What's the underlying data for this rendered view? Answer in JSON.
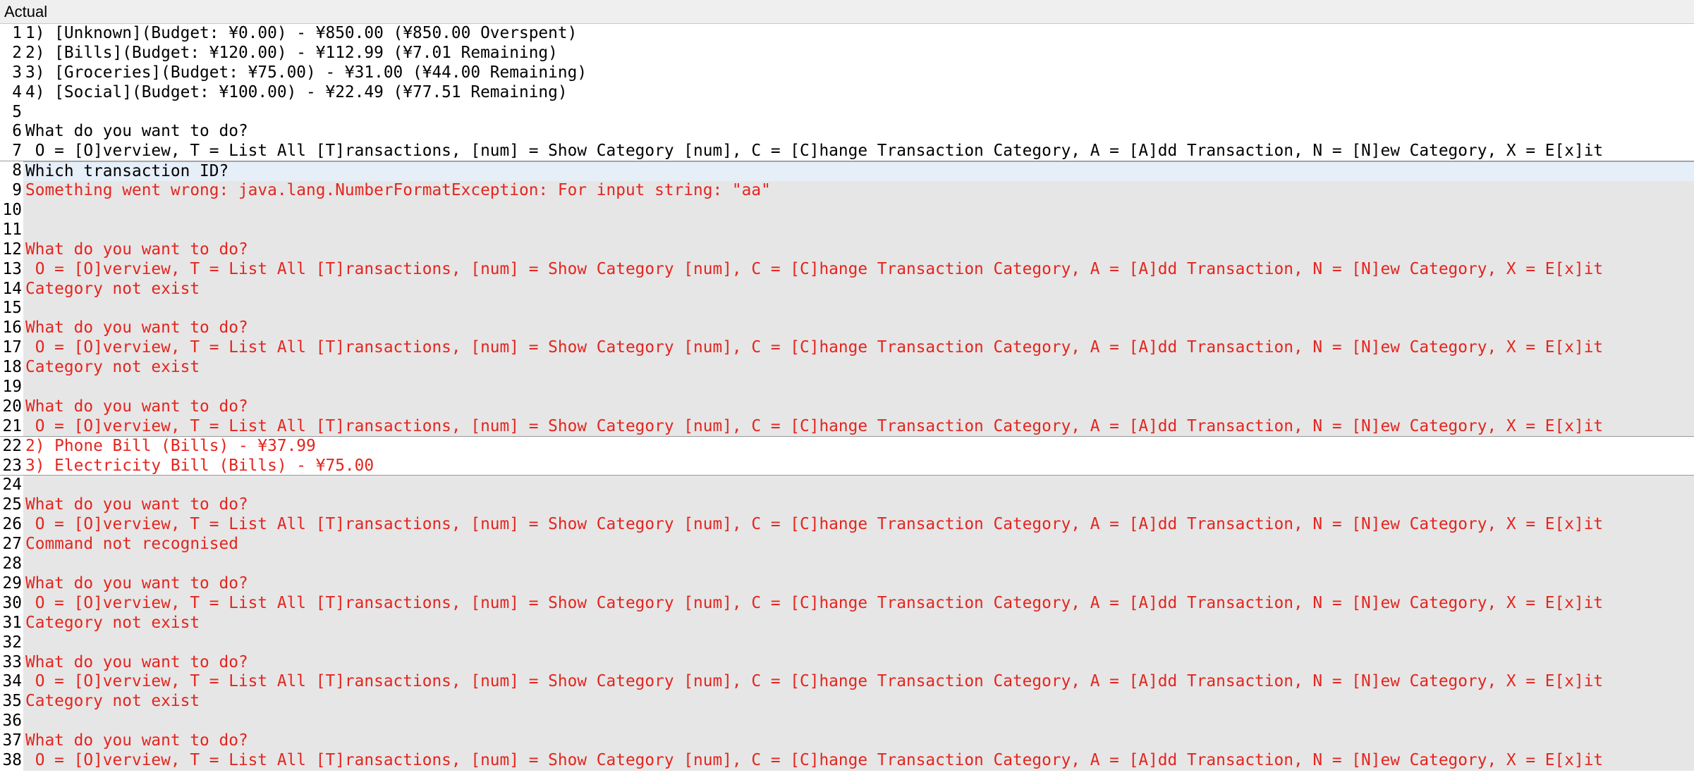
{
  "panel": {
    "title": "Actual"
  },
  "lines": [
    {
      "num": "1",
      "text": "1) [Unknown](Budget: ¥0.00) - ¥850.00 (¥850.00 Overspent)",
      "state": "normal"
    },
    {
      "num": "2",
      "text": "2) [Bills](Budget: ¥120.00) - ¥112.99 (¥7.01 Remaining)",
      "state": "normal"
    },
    {
      "num": "3",
      "text": "3) [Groceries](Budget: ¥75.00) - ¥31.00 (¥44.00 Remaining)",
      "state": "normal"
    },
    {
      "num": "4",
      "text": "4) [Social](Budget: ¥100.00) - ¥22.49 (¥77.51 Remaining)",
      "state": "normal"
    },
    {
      "num": "5",
      "text": "",
      "state": "normal"
    },
    {
      "num": "6",
      "text": "What do you want to do?",
      "state": "normal"
    },
    {
      "num": "7",
      "text": " O = [O]verview, T = List All [T]ransactions, [num] = Show Category [num], C = [C]hange Transaction Category, A = [A]dd Transaction, N = [N]ew Category, X = E[x]it",
      "state": "normal"
    },
    {
      "num": "8",
      "text": "Which transaction ID?",
      "state": "first-changed"
    },
    {
      "num": "9",
      "text": "Something went wrong: java.lang.NumberFormatException: For input string: \"aa\"",
      "state": "changed"
    },
    {
      "num": "10",
      "text": "",
      "state": "changed"
    },
    {
      "num": "11",
      "text": "",
      "state": "changed"
    },
    {
      "num": "12",
      "text": "What do you want to do?",
      "state": "changed"
    },
    {
      "num": "13",
      "text": " O = [O]verview, T = List All [T]ransactions, [num] = Show Category [num], C = [C]hange Transaction Category, A = [A]dd Transaction, N = [N]ew Category, X = E[x]it",
      "state": "changed"
    },
    {
      "num": "14",
      "text": "Category not exist",
      "state": "changed"
    },
    {
      "num": "15",
      "text": "",
      "state": "changed"
    },
    {
      "num": "16",
      "text": "What do you want to do?",
      "state": "changed"
    },
    {
      "num": "17",
      "text": " O = [O]verview, T = List All [T]ransactions, [num] = Show Category [num], C = [C]hange Transaction Category, A = [A]dd Transaction, N = [N]ew Category, X = E[x]it",
      "state": "changed"
    },
    {
      "num": "18",
      "text": "Category not exist",
      "state": "changed"
    },
    {
      "num": "19",
      "text": "",
      "state": "changed"
    },
    {
      "num": "20",
      "text": "What do you want to do?",
      "state": "changed"
    },
    {
      "num": "21",
      "text": " O = [O]verview, T = List All [T]ransactions, [num] = Show Category [num], C = [C]hange Transaction Category, A = [A]dd Transaction, N = [N]ew Category, X = E[x]it",
      "state": "changed"
    },
    {
      "num": "22",
      "text": "2) Phone Bill (Bills) - ¥37.99",
      "state": "changed-light"
    },
    {
      "num": "23",
      "text": "3) Electricity Bill (Bills) - ¥75.00",
      "state": "changed-light"
    },
    {
      "num": "24",
      "text": "",
      "state": "changed"
    },
    {
      "num": "25",
      "text": "What do you want to do?",
      "state": "changed"
    },
    {
      "num": "26",
      "text": " O = [O]verview, T = List All [T]ransactions, [num] = Show Category [num], C = [C]hange Transaction Category, A = [A]dd Transaction, N = [N]ew Category, X = E[x]it",
      "state": "changed"
    },
    {
      "num": "27",
      "text": "Command not recognised",
      "state": "changed"
    },
    {
      "num": "28",
      "text": "",
      "state": "changed"
    },
    {
      "num": "29",
      "text": "What do you want to do?",
      "state": "changed"
    },
    {
      "num": "30",
      "text": " O = [O]verview, T = List All [T]ransactions, [num] = Show Category [num], C = [C]hange Transaction Category, A = [A]dd Transaction, N = [N]ew Category, X = E[x]it",
      "state": "changed"
    },
    {
      "num": "31",
      "text": "Category not exist",
      "state": "changed"
    },
    {
      "num": "32",
      "text": "",
      "state": "changed"
    },
    {
      "num": "33",
      "text": "What do you want to do?",
      "state": "changed"
    },
    {
      "num": "34",
      "text": " O = [O]verview, T = List All [T]ransactions, [num] = Show Category [num], C = [C]hange Transaction Category, A = [A]dd Transaction, N = [N]ew Category, X = E[x]it",
      "state": "changed"
    },
    {
      "num": "35",
      "text": "Category not exist",
      "state": "changed"
    },
    {
      "num": "36",
      "text": "",
      "state": "changed"
    },
    {
      "num": "37",
      "text": "What do you want to do?",
      "state": "changed"
    },
    {
      "num": "38",
      "text": " O = [O]verview, T = List All [T]ransactions, [num] = Show Category [num], C = [C]hange Transaction Category, A = [A]dd Transaction, N = [N]ew Category, X = E[x]it",
      "state": "changed"
    }
  ]
}
